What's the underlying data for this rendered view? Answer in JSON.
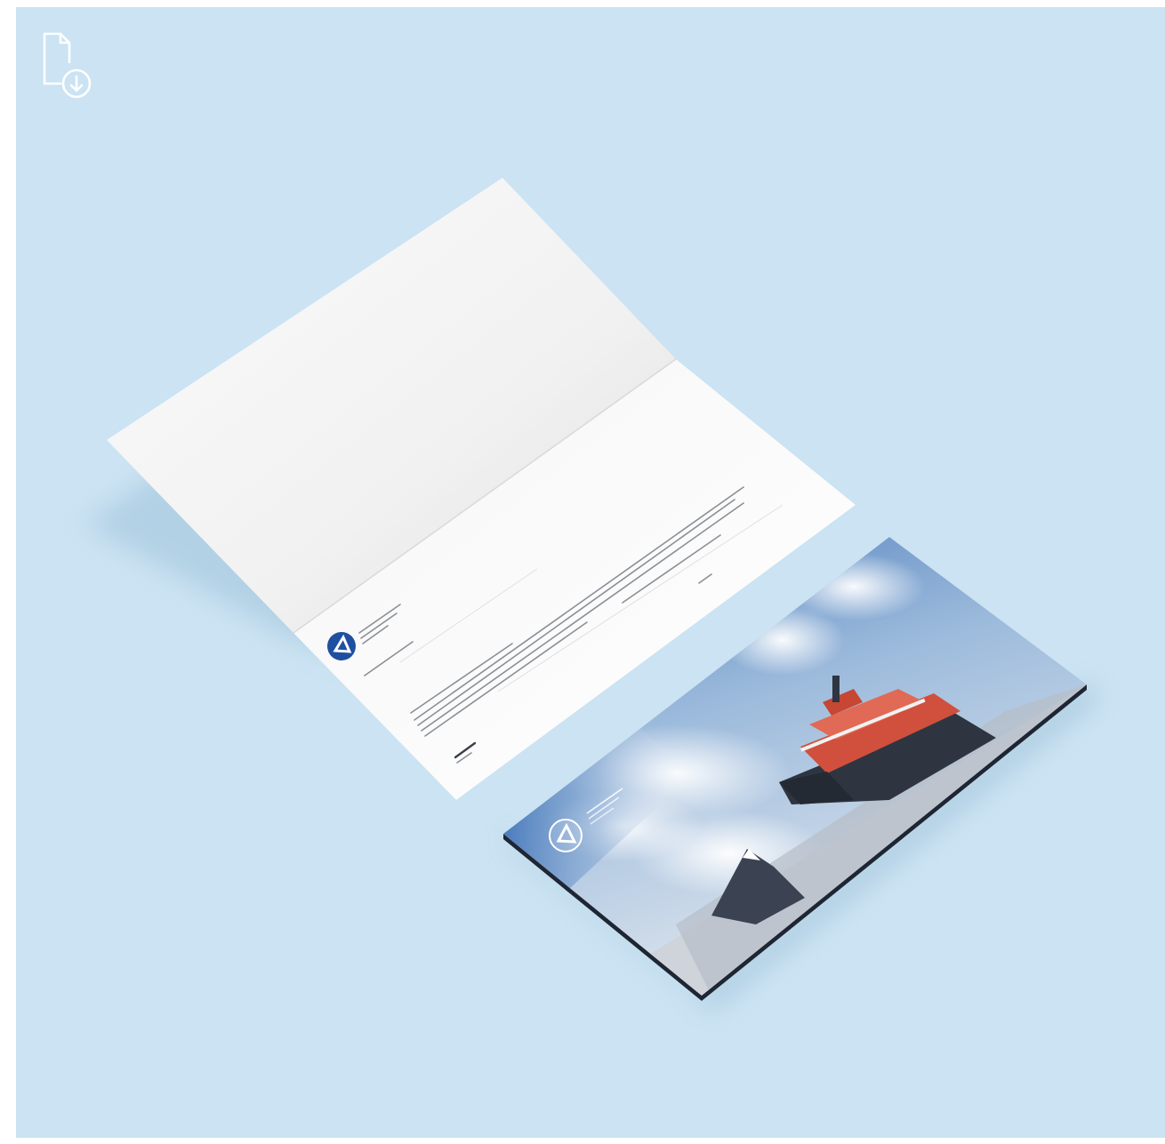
{
  "colors": {
    "backdrop": "#cbe3f2",
    "page_border": "#ffffff",
    "paper_light": "#f7f7f7",
    "paper_shade": "#e4e4e4",
    "logo_blue": "#1f4fa0",
    "hull_dark": "#2e3540",
    "superstructure_red": "#d0503d",
    "sky_blue": "#5e8fc6",
    "ice_grey": "#c7ccd3"
  },
  "icons": {
    "download": "file-download-icon"
  },
  "scene": {
    "description_items": [
      "folded-letter",
      "envelope-card"
    ]
  }
}
